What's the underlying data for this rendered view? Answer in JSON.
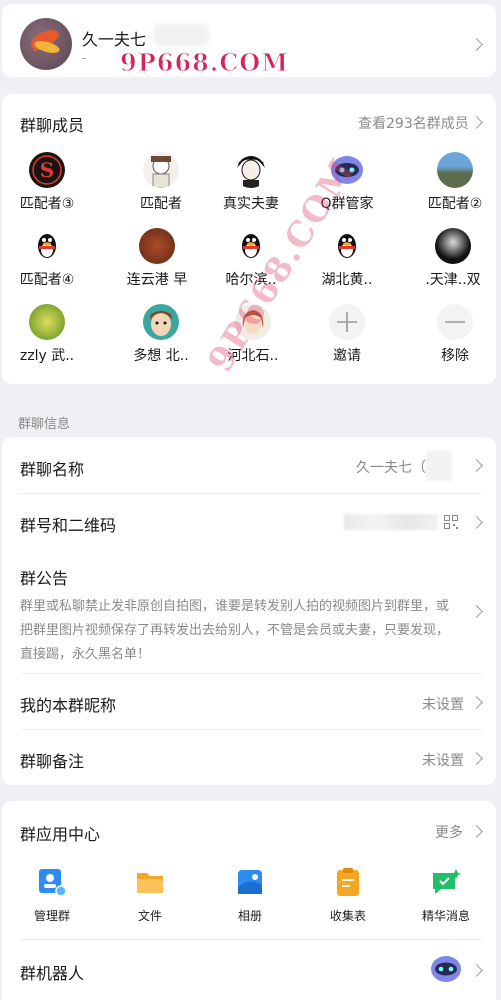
{
  "header": {
    "nickname": "久一夫七",
    "sub": "-",
    "watermark": "9P668.COM"
  },
  "members": {
    "title": "群聊成员",
    "view_all": "查看293名群成员",
    "list": [
      {
        "name": "匹配者③",
        "avatar": "s-logo-icon"
      },
      {
        "name": "匹配者",
        "avatar": "cartoon-boy-icon"
      },
      {
        "name": "真实夫妻",
        "avatar": "anime-boy-icon"
      },
      {
        "name": "Q群管家",
        "avatar": "robot-icon"
      },
      {
        "name": "匹配者②",
        "avatar": "landscape-icon"
      },
      {
        "name": "匹配者④",
        "avatar": "penguin-icon"
      },
      {
        "name": "连云港  早",
        "avatar": "food-icon"
      },
      {
        "name": "哈尔滨..",
        "avatar": "penguin-icon"
      },
      {
        "name": "湖北黄..",
        "avatar": "penguin-icon"
      },
      {
        "name": ".天津..双",
        "avatar": "dark-figure-icon"
      },
      {
        "name": "zzly  武..",
        "avatar": "green-flower-icon"
      },
      {
        "name": "多想  北..",
        "avatar": "cartoon-face-icon"
      },
      {
        "name": "河北石..",
        "avatar": "girl-icon"
      },
      {
        "name": "邀请",
        "avatar": "plus-icon"
      },
      {
        "name": "移除",
        "avatar": "minus-icon"
      }
    ],
    "diag_watermark": "9P668.COM"
  },
  "info": {
    "section_label": "群聊信息",
    "name_label": "群聊名称",
    "name_value": "久一夫七（",
    "qr_label": "群号和二维码",
    "notice_label": "群公告",
    "notice_text": "群里或私聊禁止发非原创自拍图，谁要是转发别人拍的视频图片到群里，或把群里图片视频保存了再转发出去给别人，不管是会员或夫妻，只要发现，直接踢，永久黑名单！",
    "nick_label": "我的本群昵称",
    "nick_value": "未设置",
    "remark_label": "群聊备注",
    "remark_value": "未设置"
  },
  "apps": {
    "title": "群应用中心",
    "more": "更多",
    "items": [
      {
        "label": "管理群",
        "icon": "manage-group-icon"
      },
      {
        "label": "文件",
        "icon": "folder-icon"
      },
      {
        "label": "相册",
        "icon": "album-icon"
      },
      {
        "label": "收集表",
        "icon": "clipboard-icon"
      },
      {
        "label": "精华消息",
        "icon": "essence-message-icon"
      }
    ],
    "robot_label": "群机器人"
  },
  "colors": {
    "accent_blue": "#2d8cf0",
    "folder": "#f5a623",
    "essence": "#1fbf6b",
    "watermark": "#d6245a"
  }
}
